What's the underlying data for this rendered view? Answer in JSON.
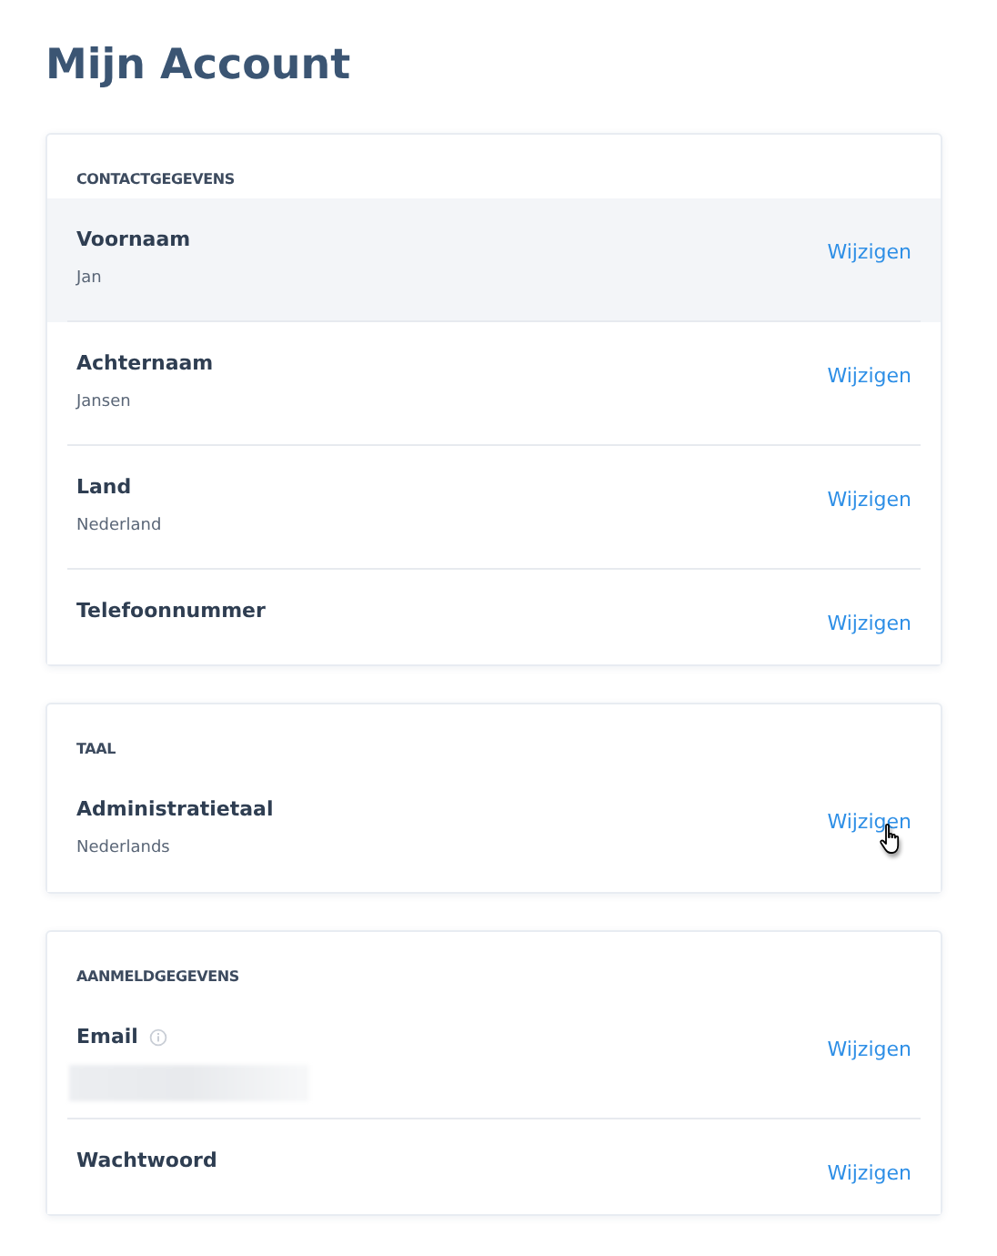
{
  "title": "Mijn Account",
  "sections": [
    {
      "heading": "CONTACTGEGEVENS",
      "rows": [
        {
          "label": "Voornaam",
          "value": "Jan",
          "action": "Wijzigen",
          "highlighted": true
        },
        {
          "label": "Achternaam",
          "value": "Jansen",
          "action": "Wijzigen",
          "highlighted": false
        },
        {
          "label": "Land",
          "value": "Nederland",
          "action": "Wijzigen",
          "highlighted": false
        },
        {
          "label": "Telefoonnummer",
          "action": "Wijzigen",
          "highlighted": false
        }
      ]
    },
    {
      "heading": "TAAL",
      "rows": [
        {
          "label": "Administratietaal",
          "value": "Nederlands",
          "action": "Wijzigen",
          "highlighted": false,
          "pointer": true
        }
      ]
    },
    {
      "heading": "AANMELDGEGEVENS",
      "rows": [
        {
          "label": "Email",
          "action": "Wijzigen",
          "highlighted": false,
          "info": true,
          "redacted": true
        },
        {
          "label": "Wachtwoord",
          "action": "Wijzigen",
          "highlighted": false
        }
      ]
    }
  ]
}
